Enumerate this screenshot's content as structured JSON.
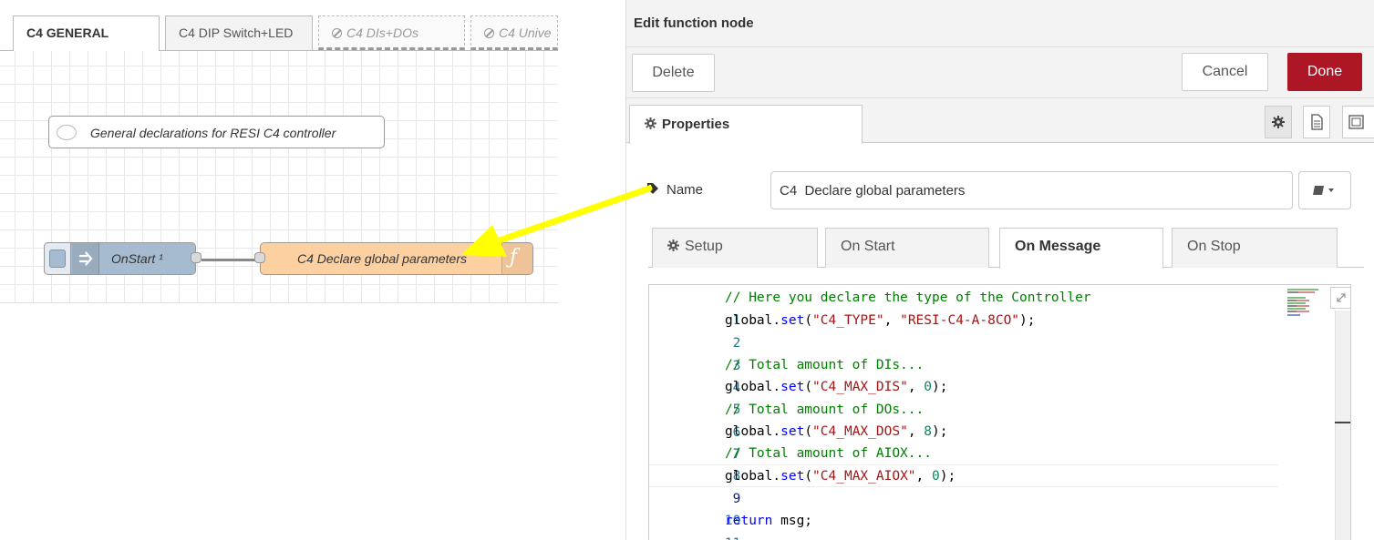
{
  "workspace": {
    "tabs": [
      {
        "label": "C4 GENERAL"
      },
      {
        "label": "C4 DIP Switch+LED"
      },
      {
        "label": "C4 DIs+DOs"
      },
      {
        "label": "C4 Unive"
      }
    ],
    "nodes": {
      "comment": {
        "label": "General declarations for RESI C4 controller"
      },
      "inject": {
        "label": "OnStart ¹"
      },
      "function": {
        "label": "C4 Declare global parameters",
        "icon": "function-icon"
      }
    },
    "colors": {
      "inject": "#a6bbcf",
      "function": "#fdd0a2",
      "annotation_arrow": "#ffff00"
    }
  },
  "editor": {
    "title": "Edit function node",
    "buttons": {
      "delete": "Delete",
      "cancel": "Cancel",
      "done": "Done"
    },
    "colors": {
      "done": "#ad1625"
    },
    "properties_tab": "Properties",
    "name_label": "Name",
    "name_value": "C4  Declare global parameters",
    "function_tabs": [
      {
        "label": "Setup"
      },
      {
        "label": "On Start"
      },
      {
        "label": "On Message"
      },
      {
        "label": "On Stop"
      }
    ],
    "code": {
      "lines": [
        {
          "num": "1",
          "comment": "// Here you declare the type of the Controller"
        },
        {
          "num": "2",
          "obj": "global.",
          "fn": "set",
          "open": "(",
          "s1": "\"C4_TYPE\"",
          "sep": ", ",
          "s2": "\"RESI-C4-A-8CO\"",
          "close": ");"
        },
        {
          "num": "3"
        },
        {
          "num": "4",
          "comment": "// Total amount of DIs..."
        },
        {
          "num": "5",
          "obj": "global.",
          "fn": "set",
          "open": "(",
          "s1": "\"C4_MAX_DIS\"",
          "sep": ", ",
          "n": "0",
          "close": ");"
        },
        {
          "num": "6",
          "comment": "// Total amount of DOs..."
        },
        {
          "num": "7",
          "obj": "global.",
          "fn": "set",
          "open": "(",
          "s1": "\"C4_MAX_DOS\"",
          "sep": ", ",
          "n": "8",
          "close": ");"
        },
        {
          "num": "8",
          "comment": "// Total amount of AIOX..."
        },
        {
          "num": "9",
          "obj": "global.",
          "fn": "set",
          "open": "(",
          "s1": "\"C4_MAX_AIOX\"",
          "sep": ", ",
          "n": "0",
          "close": ");"
        },
        {
          "num": "10"
        },
        {
          "num": "11",
          "kw": "return",
          "rest": " msg;"
        }
      ]
    }
  }
}
